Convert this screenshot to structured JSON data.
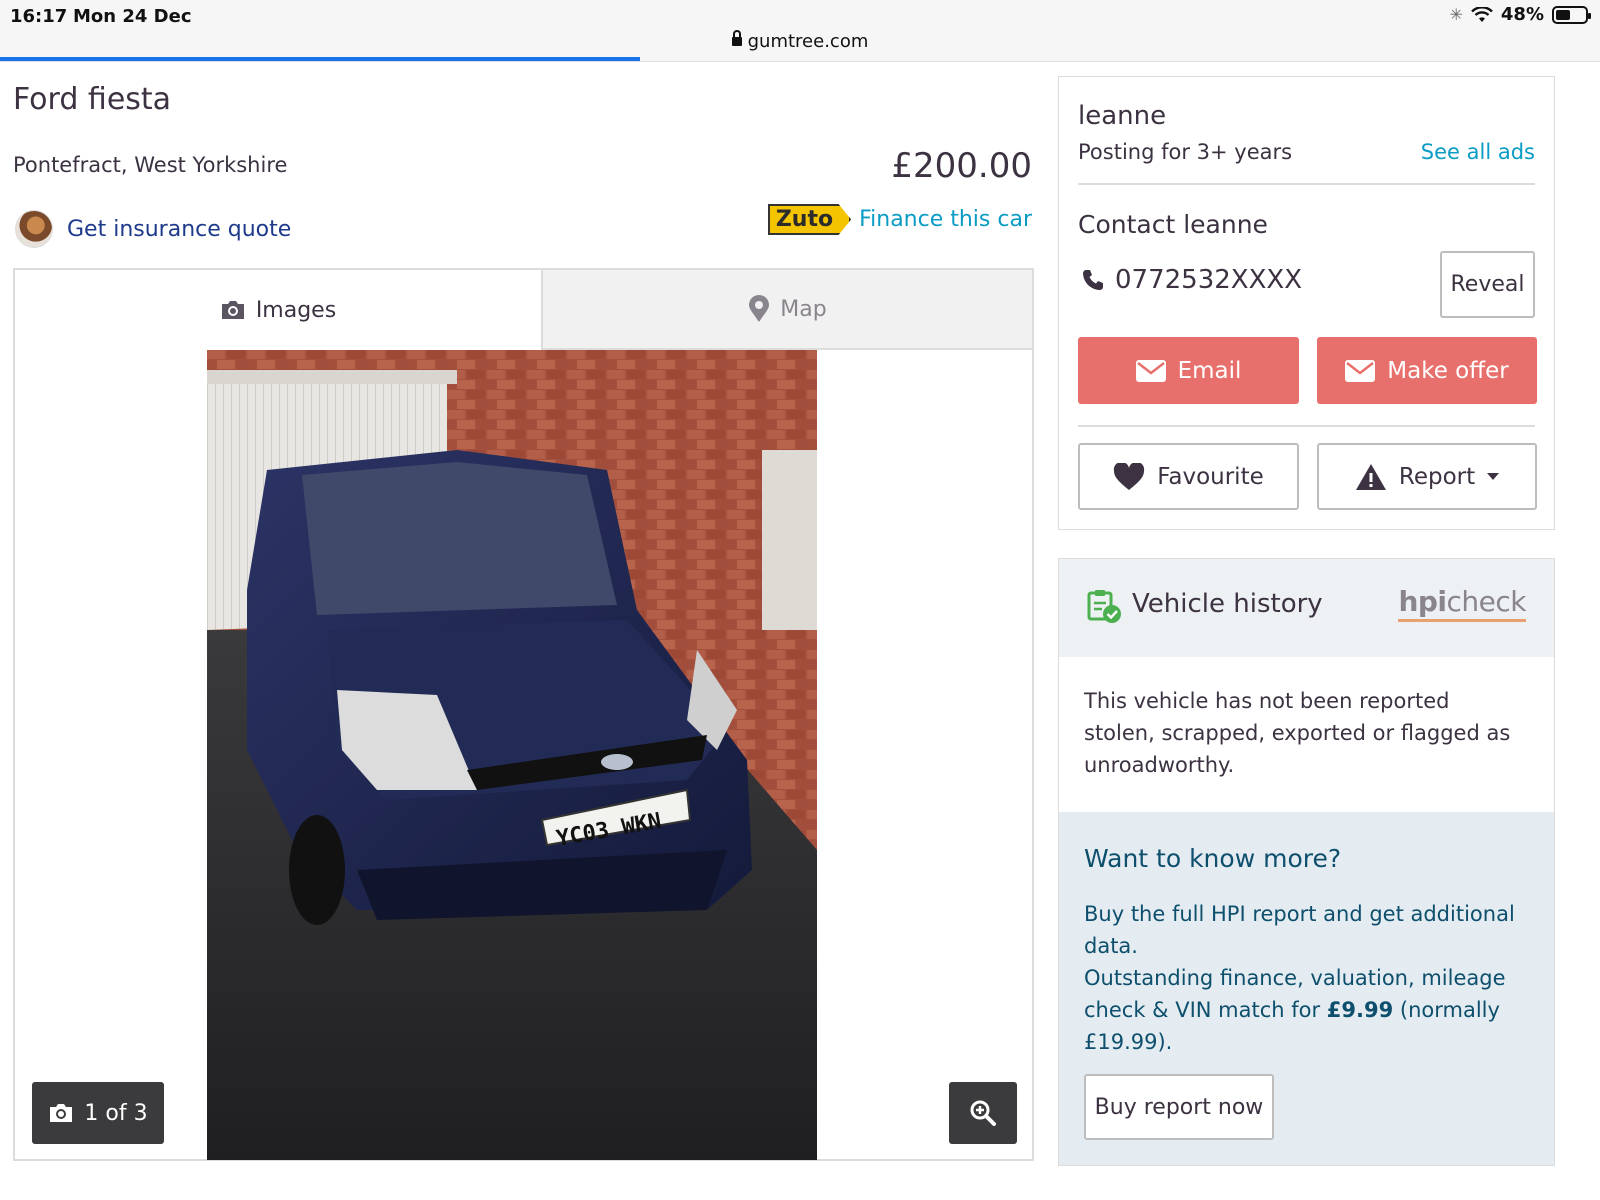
{
  "status_bar": {
    "time": "16:17",
    "date": "Mon 24 Dec",
    "battery": "48%"
  },
  "browser": {
    "url": "gumtree.com",
    "load_progress": 0.4
  },
  "listing": {
    "title": "Ford fiesta",
    "location": "Pontefract, West Yorkshire",
    "price": "£200.00",
    "insurance_label": "Get insurance quote",
    "finance_brand": "Zuto",
    "finance_label": "Finance this car"
  },
  "gallery": {
    "tabs": [
      {
        "label": "Images",
        "icon": "camera-icon",
        "active": true
      },
      {
        "label": "Map",
        "icon": "map-pin-icon",
        "active": false
      }
    ],
    "counter": "1 of 3",
    "plate": "YC03 WKN"
  },
  "seller": {
    "name": "leanne",
    "since": "Posting for 3+ years",
    "see_all": "See all ads",
    "contact_title": "Contact leanne",
    "phone": "0772532XXXX",
    "reveal": "Reveal",
    "email": "Email",
    "make_offer": "Make offer",
    "favourite": "Favourite",
    "report": "Report"
  },
  "hpi": {
    "title": "Vehicle history",
    "logo_a": "hpi",
    "logo_b": "check",
    "status_text": "This vehicle has not been reported stolen, scrapped, exported or flagged as unroadworthy.",
    "more_title": "Want to know more?",
    "more_line1": "Buy the full HPI report and get additional data.",
    "more_line2_pre": "Outstanding finance, valuation, mileage check & VIN match for ",
    "more_price": "£9.99",
    "more_line2_post": " (normally £19.99).",
    "buy_button": "Buy report now"
  },
  "colors": {
    "accent_red": "#e8706c",
    "link_blue": "#0a9cc4",
    "insurance_blue": "#1e3a8a",
    "hpi_text": "#0d4f6d"
  }
}
